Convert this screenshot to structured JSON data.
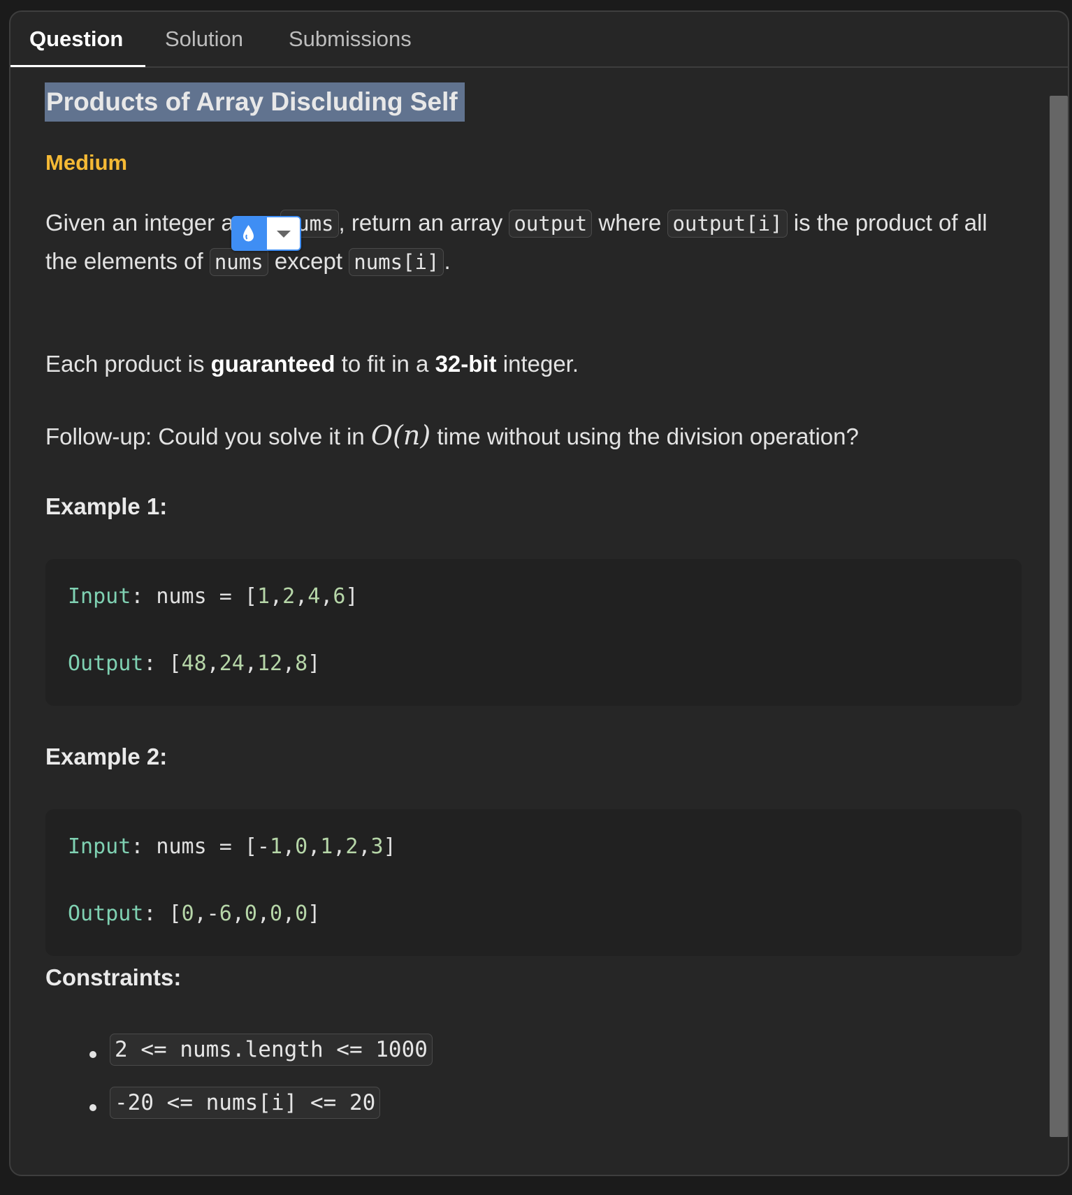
{
  "tabs": {
    "question": "Question",
    "solution": "Solution",
    "submissions": "Submissions"
  },
  "problem": {
    "title": "Products of Array Discluding Self",
    "difficulty": "Medium",
    "difficulty_color": "#f5b935",
    "p1": {
      "t1": "Given an integer array ",
      "c1": "nums",
      "t2": ", return an array ",
      "c2": "output",
      "t3": " where ",
      "c3": "output[i]",
      "t4": " is the product of all",
      "t5": "the elements of ",
      "c4": "nums",
      "t6": " except ",
      "c5": "nums[i]",
      "t7": "."
    },
    "p2": {
      "t1": "Each product is ",
      "b1": "guaranteed",
      "t2": " to fit in a ",
      "b2": "32-bit",
      "t3": " integer."
    },
    "p3": {
      "t1": "Follow-up: Could you solve it in ",
      "math": "O(n)",
      "t2": " time without using the division operation?"
    }
  },
  "examples": [
    {
      "heading": "Example 1:",
      "input_label": "Input",
      "input_value": ": nums = [1,2,4,6]",
      "output_label": "Output",
      "output_value": ": [48,24,12,8]"
    },
    {
      "heading": "Example 2:",
      "input_label": "Input",
      "input_value": ": nums = [-1,0,1,2,3]",
      "output_label": "Output",
      "output_value": ": [0,-6,0,0,0]"
    }
  ],
  "constraints": {
    "heading": "Constraints:",
    "items": [
      "2 <= nums.length <= 1000",
      "-20 <= nums[i] <= 20"
    ]
  },
  "widget": {
    "left_icon": "droplet-icon",
    "right_icon": "caret-down-icon",
    "accent": "#3f8ef4"
  }
}
